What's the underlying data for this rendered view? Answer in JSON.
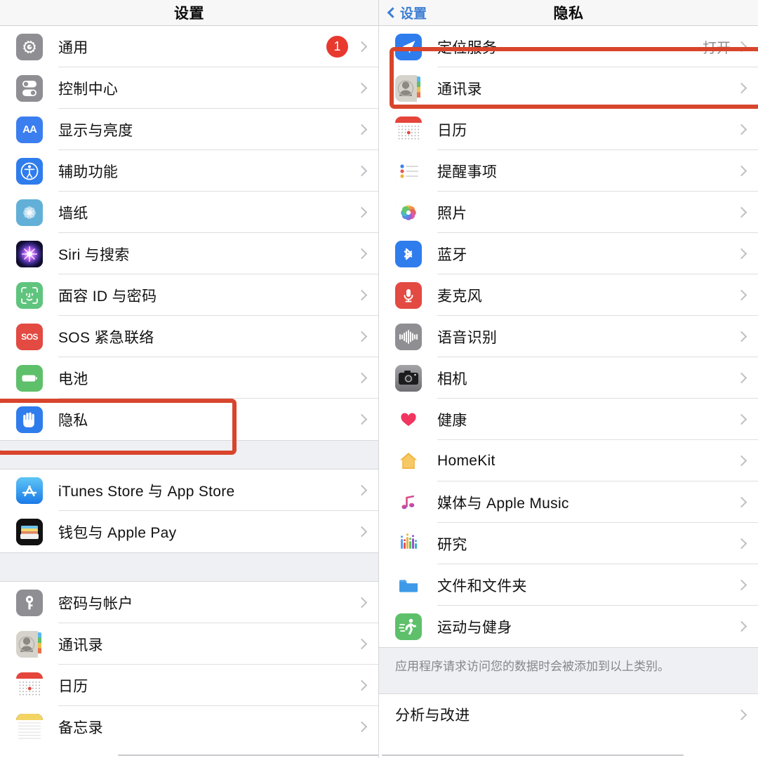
{
  "left_panel": {
    "nav": {
      "title": "设置"
    },
    "groups": [
      {
        "items": [
          {
            "label": "通用",
            "icon": "gear-icon",
            "badge": "1",
            "accessory": "chevron-right-icon"
          },
          {
            "label": "控制中心",
            "icon": "control-center-icon",
            "accessory": "chevron-right-icon"
          },
          {
            "label": "显示与亮度",
            "icon": "display-brightness-icon",
            "accessory": "chevron-right-icon"
          },
          {
            "label": "辅助功能",
            "icon": "accessibility-icon",
            "accessory": "chevron-right-icon"
          },
          {
            "label": "墙纸",
            "icon": "wallpaper-icon",
            "accessory": "chevron-right-icon"
          },
          {
            "label": "Siri 与搜索",
            "icon": "siri-icon",
            "accessory": "chevron-right-icon"
          },
          {
            "label": "面容 ID 与密码",
            "icon": "face-id-icon",
            "accessory": "chevron-right-icon"
          },
          {
            "label": "SOS 紧急联络",
            "icon": "sos-icon",
            "accessory": "chevron-right-icon"
          },
          {
            "label": "电池",
            "icon": "battery-icon",
            "accessory": "chevron-right-icon"
          },
          {
            "label": "隐私",
            "icon": "privacy-hand-icon",
            "accessory": "chevron-right-icon",
            "highlighted": true
          }
        ]
      },
      {
        "items": [
          {
            "label": "iTunes Store 与 App Store",
            "icon": "app-store-icon",
            "accessory": "chevron-right-icon"
          },
          {
            "label": "钱包与 Apple Pay",
            "icon": "wallet-icon",
            "accessory": "chevron-right-icon"
          }
        ]
      },
      {
        "items": [
          {
            "label": "密码与帐户",
            "icon": "passwords-key-icon",
            "accessory": "chevron-right-icon"
          },
          {
            "label": "通讯录",
            "icon": "contacts-icon",
            "accessory": "chevron-right-icon"
          },
          {
            "label": "日历",
            "icon": "calendar-icon",
            "accessory": "chevron-right-icon"
          },
          {
            "label": "备忘录",
            "icon": "notes-icon",
            "accessory": "chevron-right-icon"
          }
        ]
      }
    ]
  },
  "right_panel": {
    "nav": {
      "back_label": "设置",
      "back_icon": "chevron-left-icon",
      "title": "隐私"
    },
    "groups": [
      {
        "items": [
          {
            "label": "定位服务",
            "icon": "location-services-icon",
            "value": "打开",
            "accessory": "chevron-right-icon",
            "highlighted": true
          },
          {
            "label": "通讯录",
            "icon": "contacts-icon",
            "accessory": "chevron-right-icon"
          },
          {
            "label": "日历",
            "icon": "calendar-icon",
            "accessory": "chevron-right-icon"
          },
          {
            "label": "提醒事项",
            "icon": "reminders-icon",
            "accessory": "chevron-right-icon"
          },
          {
            "label": "照片",
            "icon": "photos-icon",
            "accessory": "chevron-right-icon"
          },
          {
            "label": "蓝牙",
            "icon": "bluetooth-icon",
            "accessory": "chevron-right-icon"
          },
          {
            "label": "麦克风",
            "icon": "microphone-icon",
            "accessory": "chevron-right-icon"
          },
          {
            "label": "语音识别",
            "icon": "speech-recognition-icon",
            "accessory": "chevron-right-icon"
          },
          {
            "label": "相机",
            "icon": "camera-icon",
            "accessory": "chevron-right-icon"
          },
          {
            "label": "健康",
            "icon": "health-heart-icon",
            "accessory": "chevron-right-icon"
          },
          {
            "label": "HomeKit",
            "icon": "homekit-icon",
            "accessory": "chevron-right-icon"
          },
          {
            "label": "媒体与 Apple Music",
            "icon": "music-icon",
            "accessory": "chevron-right-icon"
          },
          {
            "label": "研究",
            "icon": "research-icon",
            "accessory": "chevron-right-icon"
          },
          {
            "label": "文件和文件夹",
            "icon": "files-folder-icon",
            "accessory": "chevron-right-icon"
          },
          {
            "label": "运动与健身",
            "icon": "fitness-icon",
            "accessory": "chevron-right-icon"
          }
        ]
      }
    ],
    "footnote": "应用程序请求访问您的数据时会被添加到以上类别。",
    "bottom_group": {
      "items": [
        {
          "label": "分析与改进",
          "icon": null,
          "accessory": "chevron-right-icon"
        }
      ]
    }
  },
  "colors": {
    "highlight_box": "#d8452c",
    "badge": "#e8392e",
    "link": "#3d7fd1",
    "group_background": "#eff0f3",
    "separator": "#dededf"
  }
}
